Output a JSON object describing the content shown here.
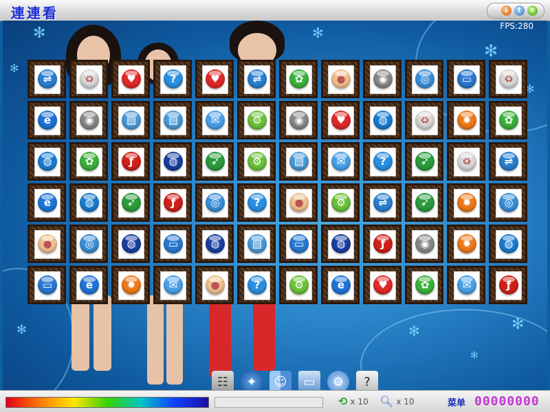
{
  "window": {
    "title": "連連看",
    "buttons": [
      "minimize",
      "maximize",
      "close"
    ]
  },
  "hud": {
    "fps": "FPS:280"
  },
  "board": {
    "rows": 6,
    "cols": 12,
    "tiles": [
      [
        "usb",
        "recycle",
        "heart",
        "help",
        "heart",
        "usb",
        "flower",
        "pig",
        "webcam",
        "joystick",
        "monitor",
        "recycle"
      ],
      [
        "ie",
        "webcam",
        "picture",
        "picture",
        "mail",
        "gear",
        "webcam",
        "heart",
        "globe",
        "recycle",
        "firefox",
        "flower"
      ],
      [
        "globe",
        "flower",
        "flash",
        "globe-dark",
        "feather",
        "gear",
        "picture",
        "mail",
        "help",
        "feather",
        "recycle",
        "usb"
      ],
      [
        "ie",
        "globe",
        "feather",
        "flash",
        "joystick",
        "help",
        "pig",
        "gear",
        "usb",
        "feather",
        "firefox",
        "joystick"
      ],
      [
        "pig",
        "joystick",
        "globe-dark",
        "monitor",
        "globe-dark",
        "picture",
        "monitor",
        "globe-dark",
        "flash",
        "webcam",
        "firefox",
        "globe"
      ],
      [
        "monitor",
        "ie",
        "firefox",
        "mail",
        "pig",
        "help",
        "gear",
        "ie",
        "heart",
        "flower",
        "mail",
        "flash"
      ]
    ],
    "icon_colors": {
      "usb": "#2a7fd0",
      "recycle": "#d8d8d8",
      "heart": "#e02a2a",
      "help": "#2a8fe0",
      "flower": "#3bb23b",
      "pig": "#f0c090",
      "webcam": "#888888",
      "joystick": "#3a8fd8",
      "monitor": "#2a78d0",
      "ie": "#1f74d8",
      "picture": "#4a9ad8",
      "mail": "#4aa0e8",
      "gear": "#6cc23a",
      "globe": "#1a7cd0",
      "firefox": "#ee7a1a",
      "flash": "#d0201a",
      "globe-dark": "#1a3fa0",
      "feather": "#2c9c3c"
    }
  },
  "toolbar": {
    "items": [
      "settings-icon",
      "compass-icon",
      "finder-icon",
      "drive-icon",
      "gear-icon",
      "help-icon"
    ]
  },
  "status": {
    "time_remaining": 1.0,
    "shuffle_count": "x 10",
    "hint_count": "x 10",
    "menu_label": "菜单",
    "score": "00000000"
  }
}
